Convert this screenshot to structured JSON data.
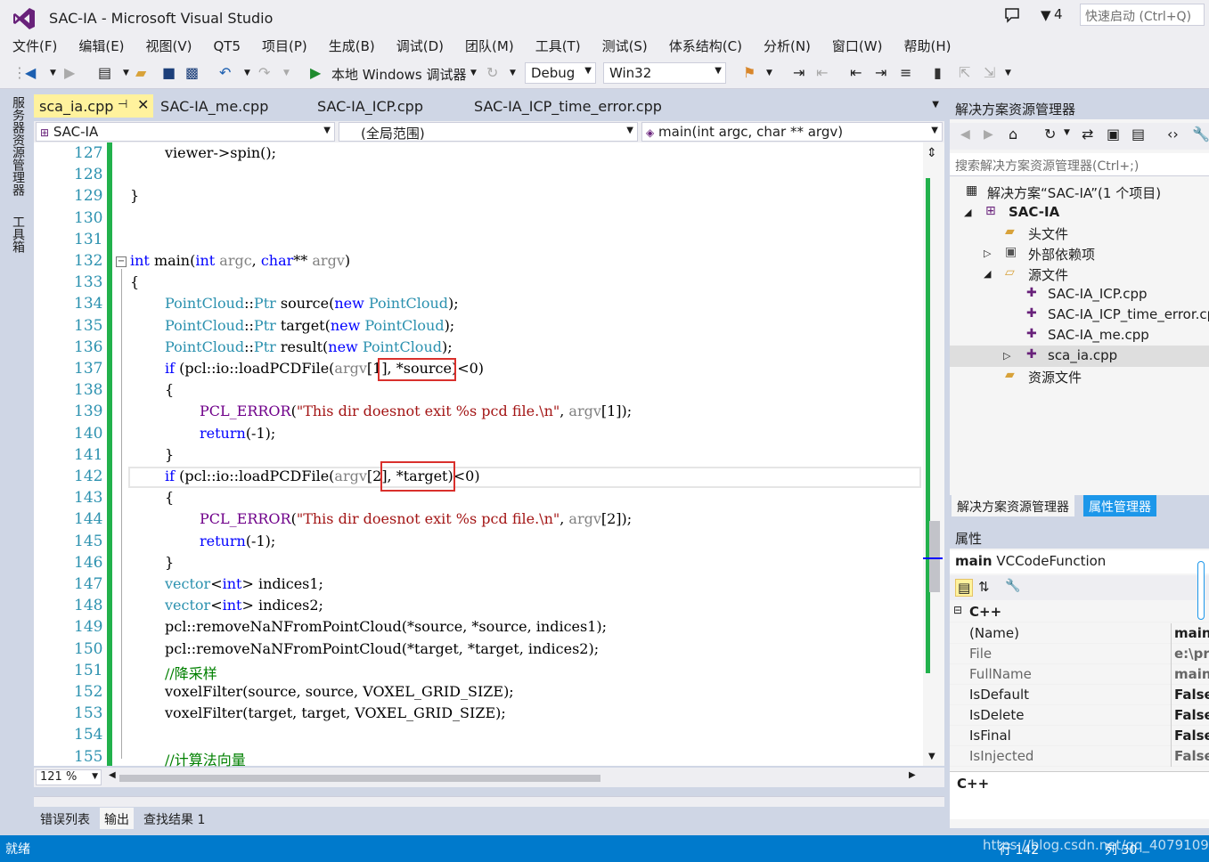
{
  "window": {
    "title": "SAC-IA - Microsoft Visual Studio",
    "filter_count": "4",
    "quick_launch_placeholder": "快速启动 (Ctrl+Q)"
  },
  "menu": [
    "文件(F)",
    "编辑(E)",
    "视图(V)",
    "QT5",
    "项目(P)",
    "生成(B)",
    "调试(D)",
    "团队(M)",
    "工具(T)",
    "测试(S)",
    "体系结构(C)",
    "分析(N)",
    "窗口(W)",
    "帮助(H)"
  ],
  "toolbar": {
    "run_label": "本地 Windows 调试器",
    "config": "Debug",
    "platform": "Win32"
  },
  "side_tabs": [
    "服务器资源管理器",
    "工具箱"
  ],
  "editor_tabs": [
    "sca_ia.cpp",
    "SAC-IA_me.cpp",
    "SAC-IA_ICP.cpp",
    "SAC-IA_ICP_time_error.cpp"
  ],
  "navbar": {
    "project": "SAC-IA",
    "scope": "(全局范围)",
    "member": "main(int argc, char ** argv)"
  },
  "zoom": "121 %",
  "code_lines": [
    {
      "n": "127",
      "indent": 1,
      "parts": [
        [
          "t",
          "viewer->spin();"
        ]
      ]
    },
    {
      "n": "128",
      "indent": 0,
      "parts": []
    },
    {
      "n": "129",
      "indent": 0,
      "parts": [
        [
          "t",
          "}"
        ]
      ]
    },
    {
      "n": "130",
      "indent": 0,
      "parts": []
    },
    {
      "n": "131",
      "indent": 0,
      "parts": []
    },
    {
      "n": "132",
      "indent": 0,
      "parts": [
        [
          "kw",
          "int"
        ],
        [
          "t",
          " main("
        ],
        [
          "kw",
          "int"
        ],
        [
          "t",
          " "
        ],
        [
          "prm",
          "argc"
        ],
        [
          "t",
          ", "
        ],
        [
          "kw",
          "char"
        ],
        [
          "t",
          "** "
        ],
        [
          "prm",
          "argv"
        ],
        [
          "t",
          ")"
        ]
      ]
    },
    {
      "n": "133",
      "indent": 0,
      "parts": [
        [
          "t",
          "{"
        ]
      ]
    },
    {
      "n": "134",
      "indent": 1,
      "parts": [
        [
          "ty",
          "PointCloud"
        ],
        [
          "t",
          "::"
        ],
        [
          "ty",
          "Ptr"
        ],
        [
          "t",
          " source("
        ],
        [
          "kw",
          "new"
        ],
        [
          "t",
          " "
        ],
        [
          "ty",
          "PointCloud"
        ],
        [
          "t",
          ");"
        ]
      ]
    },
    {
      "n": "135",
      "indent": 1,
      "parts": [
        [
          "ty",
          "PointCloud"
        ],
        [
          "t",
          "::"
        ],
        [
          "ty",
          "Ptr"
        ],
        [
          "t",
          " target("
        ],
        [
          "kw",
          "new"
        ],
        [
          "t",
          " "
        ],
        [
          "ty",
          "PointCloud"
        ],
        [
          "t",
          ");"
        ]
      ]
    },
    {
      "n": "136",
      "indent": 1,
      "parts": [
        [
          "ty",
          "PointCloud"
        ],
        [
          "t",
          "::"
        ],
        [
          "ty",
          "Ptr"
        ],
        [
          "t",
          " result("
        ],
        [
          "kw",
          "new"
        ],
        [
          "t",
          " "
        ],
        [
          "ty",
          "PointCloud"
        ],
        [
          "t",
          ");"
        ]
      ]
    },
    {
      "n": "137",
      "indent": 1,
      "parts": [
        [
          "kw",
          "if"
        ],
        [
          "t",
          " (pcl::io::loadPCDFile("
        ],
        [
          "prm",
          "argv"
        ],
        [
          "t",
          "[1], *source)<0)"
        ]
      ]
    },
    {
      "n": "138",
      "indent": 1,
      "parts": [
        [
          "t",
          "{"
        ]
      ]
    },
    {
      "n": "139",
      "indent": 2,
      "parts": [
        [
          "mac",
          "PCL_ERROR"
        ],
        [
          "t",
          "("
        ],
        [
          "str",
          "\"This dir doesnot exit %s pcd file.\\n\""
        ],
        [
          "t",
          ", "
        ],
        [
          "prm",
          "argv"
        ],
        [
          "t",
          "[1]);"
        ]
      ]
    },
    {
      "n": "140",
      "indent": 2,
      "parts": [
        [
          "kw",
          "return"
        ],
        [
          "t",
          "(-1);"
        ]
      ]
    },
    {
      "n": "141",
      "indent": 1,
      "parts": [
        [
          "t",
          "}"
        ]
      ]
    },
    {
      "n": "142",
      "indent": 1,
      "parts": [
        [
          "kw",
          "if"
        ],
        [
          "t",
          " (pcl::io::loadPCDFile("
        ],
        [
          "prm",
          "argv"
        ],
        [
          "t",
          "[2], *target)<0)"
        ]
      ]
    },
    {
      "n": "143",
      "indent": 1,
      "parts": [
        [
          "t",
          "{"
        ]
      ]
    },
    {
      "n": "144",
      "indent": 2,
      "parts": [
        [
          "mac",
          "PCL_ERROR"
        ],
        [
          "t",
          "("
        ],
        [
          "str",
          "\"This dir doesnot exit %s pcd file.\\n\""
        ],
        [
          "t",
          ", "
        ],
        [
          "prm",
          "argv"
        ],
        [
          "t",
          "[2]);"
        ]
      ]
    },
    {
      "n": "145",
      "indent": 2,
      "parts": [
        [
          "kw",
          "return"
        ],
        [
          "t",
          "(-1);"
        ]
      ]
    },
    {
      "n": "146",
      "indent": 1,
      "parts": [
        [
          "t",
          "}"
        ]
      ]
    },
    {
      "n": "147",
      "indent": 1,
      "parts": [
        [
          "ty",
          "vector"
        ],
        [
          "t",
          "<"
        ],
        [
          "kw",
          "int"
        ],
        [
          "t",
          "> indices1;"
        ]
      ]
    },
    {
      "n": "148",
      "indent": 1,
      "parts": [
        [
          "ty",
          "vector"
        ],
        [
          "t",
          "<"
        ],
        [
          "kw",
          "int"
        ],
        [
          "t",
          "> indices2;"
        ]
      ]
    },
    {
      "n": "149",
      "indent": 1,
      "parts": [
        [
          "t",
          "pcl::removeNaNFromPointCloud(*source, *source, indices1);"
        ]
      ]
    },
    {
      "n": "150",
      "indent": 1,
      "parts": [
        [
          "t",
          "pcl::removeNaNFromPointCloud(*target, *target, indices2);"
        ]
      ]
    },
    {
      "n": "151",
      "indent": 1,
      "parts": [
        [
          "cm",
          "//降采样"
        ]
      ]
    },
    {
      "n": "152",
      "indent": 1,
      "parts": [
        [
          "t",
          "voxelFilter(source, source, VOXEL_GRID_SIZE);"
        ]
      ]
    },
    {
      "n": "153",
      "indent": 1,
      "parts": [
        [
          "t",
          "voxelFilter(target, target, VOXEL_GRID_SIZE);"
        ]
      ]
    },
    {
      "n": "154",
      "indent": 0,
      "parts": []
    },
    {
      "n": "155",
      "indent": 1,
      "parts": [
        [
          "cm",
          "//计算法向量"
        ]
      ]
    }
  ],
  "bottom_tabs": [
    "错误列表",
    "输出",
    "查找结果 1"
  ],
  "status": {
    "ready": "就绪",
    "line": "行 142",
    "col": "列 30",
    "watermark": "https://blog.csdn.net/qq_40791099"
  },
  "solution_explorer": {
    "title": "解决方案资源管理器",
    "search_placeholder": "搜索解决方案资源管理器(Ctrl+;)",
    "solution": "解决方案“SAC-IA”(1 个项目)",
    "project": "SAC-IA",
    "folders": {
      "headers": "头文件",
      "external": "外部依赖项",
      "sources": "源文件",
      "resources": "资源文件"
    },
    "files": [
      "SAC-IA_ICP.cpp",
      "SAC-IA_ICP_time_error.cpp",
      "SAC-IA_me.cpp",
      "sca_ia.cpp"
    ],
    "tabs": [
      "解决方案资源管理器",
      "属性管理器"
    ]
  },
  "properties": {
    "title": "属性",
    "object_name": "main",
    "object_type": "VCCodeFunction",
    "category": "C++",
    "rows": [
      {
        "name": "(Name)",
        "value": "main",
        "bold": true
      },
      {
        "name": "File",
        "value": "e:\\pro",
        "bold": false
      },
      {
        "name": "FullName",
        "value": "main",
        "bold": false
      },
      {
        "name": "IsDefault",
        "value": "False",
        "bold": true
      },
      {
        "name": "IsDelete",
        "value": "False",
        "bold": true
      },
      {
        "name": "IsFinal",
        "value": "False",
        "bold": true
      },
      {
        "name": "IsInjected",
        "value": "False",
        "bold": false
      }
    ],
    "description": "C++"
  }
}
